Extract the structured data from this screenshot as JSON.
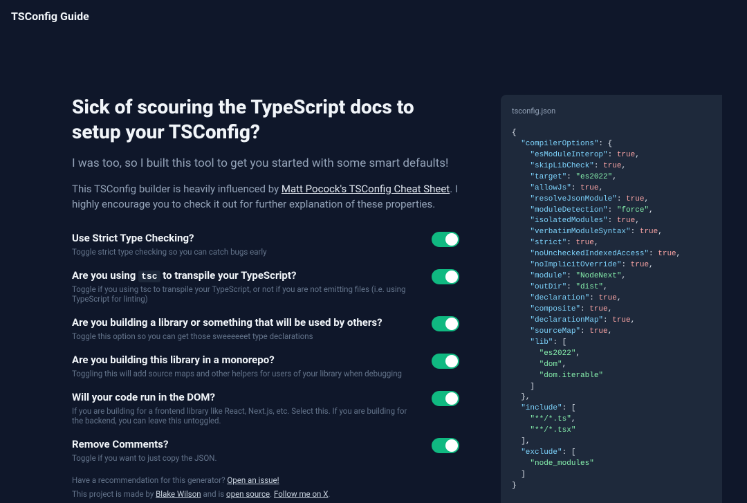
{
  "header": {
    "title": "TSConfig Guide"
  },
  "hero": {
    "title": "Sick of scouring the TypeScript docs to setup your TSConfig?",
    "subtitle": "I was too, so I built this tool to get you started with some smart defaults!",
    "desc_pre": "This TSConfig builder is heavily influenced by ",
    "link": "Matt Pocock's TSConfig Cheat Sheet",
    "desc_post": ". I highly encourage you to check it out for further explanation of these properties."
  },
  "options": [
    {
      "title": "Use Strict Type Checking?",
      "desc": "Toggle strict type checking so you can catch bugs early",
      "on": true
    },
    {
      "title_pre": "Are you using ",
      "code": "tsc",
      "title_post": " to transpile your TypeScript?",
      "desc": "Toggle if you using tsc to transpile your TypeScript, or not if you are not emitting files (i.e. using TypeScript for linting)",
      "on": true
    },
    {
      "title": "Are you building a library or something that will be used by others?",
      "desc": "Toggle this option so you can get those sweeeeeet type declarations",
      "on": true
    },
    {
      "title": "Are you building this library in a monorepo?",
      "desc": "Toggling this will add source maps and other helpers for users of your library when debugging",
      "on": true
    },
    {
      "title": "Will your code run in the DOM?",
      "desc": "If you are building for a frontend library like React, Next.js, etc. Select this. If you are building for the backend, you can leave this untoggled.",
      "on": true
    },
    {
      "title": "Remove Comments?",
      "desc": "Toggle if you want to just copy the JSON.",
      "on": true
    }
  ],
  "footer": {
    "rec": "Have a recommendation for this generator? ",
    "rec_link": "Open an issue!",
    "made": "This project is made by ",
    "author": "Blake Wilson",
    "and": " and is ",
    "open_source": "open source",
    "follow_pre": ". ",
    "follow": "Follow me on X",
    "follow_post": "."
  },
  "code_panel": {
    "filename": "tsconfig.json"
  },
  "chart_data": {
    "type": "table",
    "note": "tsconfig.json content displayed in code panel",
    "compilerOptions": {
      "esModuleInterop": true,
      "skipLibCheck": true,
      "target": "es2022",
      "allowJs": true,
      "resolveJsonModule": true,
      "moduleDetection": "force",
      "isolatedModules": true,
      "verbatimModuleSyntax": true,
      "strict": true,
      "noUncheckedIndexedAccess": true,
      "noImplicitOverride": true,
      "module": "NodeNext",
      "outDir": "dist",
      "declaration": true,
      "composite": true,
      "declarationMap": true,
      "sourceMap": true,
      "lib": [
        "es2022",
        "dom",
        "dom.iterable"
      ]
    },
    "include": [
      "**/*.ts",
      "**/*.tsx"
    ],
    "exclude": [
      "node_modules"
    ]
  }
}
